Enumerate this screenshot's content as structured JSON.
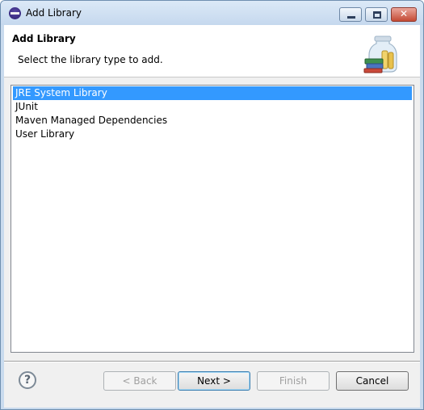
{
  "window": {
    "title": "Add Library",
    "close_glyph": "✕"
  },
  "header": {
    "title": "Add Library",
    "description": "Select the library type to add."
  },
  "library_types": {
    "items": [
      {
        "label": "JRE System Library",
        "selected": true
      },
      {
        "label": "JUnit",
        "selected": false
      },
      {
        "label": "Maven Managed Dependencies",
        "selected": false
      },
      {
        "label": "User Library",
        "selected": false
      }
    ]
  },
  "footer": {
    "help_glyph": "?",
    "back_label": "< Back",
    "next_label": "Next >",
    "finish_label": "Finish",
    "cancel_label": "Cancel"
  },
  "colors": {
    "selection": "#3399ff",
    "dialog_background": "#f0f0f0"
  }
}
